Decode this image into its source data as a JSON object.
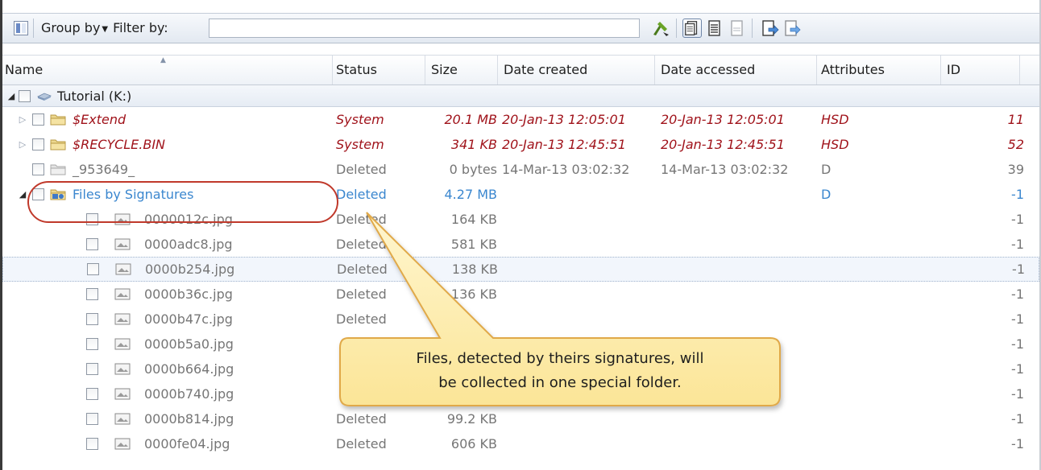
{
  "toolbar": {
    "group_by_label": "Group by",
    "filter_label": "Filter by:",
    "filter_value": "",
    "icons": [
      "panel-toggle-icon",
      "recover-icon",
      "view-details-icon",
      "view-list-icon",
      "view-plain-icon",
      "export-icon",
      "export-alt-icon"
    ]
  },
  "columns": {
    "name": "Name",
    "status": "Status",
    "size": "Size",
    "date_created": "Date created",
    "date_accessed": "Date accessed",
    "attributes": "Attributes",
    "id": "ID"
  },
  "rows": [
    {
      "name": "Tutorial (K:)",
      "status": "",
      "size": "",
      "created": "",
      "accessed": "",
      "attributes": "",
      "id": "",
      "kind": "root"
    },
    {
      "name": "$Extend",
      "status": "System",
      "size": "20.1 MB",
      "created": "20-Jan-13 12:05:01",
      "accessed": "20-Jan-13 12:05:01",
      "attributes": "HSD",
      "id": "11",
      "kind": "system"
    },
    {
      "name": "$RECYCLE.BIN",
      "status": "System",
      "size": "341 KB",
      "created": "20-Jan-13 12:45:51",
      "accessed": "20-Jan-13 12:45:51",
      "attributes": "HSD",
      "id": "52",
      "kind": "system"
    },
    {
      "name": "_953649_",
      "status": "Deleted",
      "size": "0 bytes",
      "created": "14-Mar-13 03:02:32",
      "accessed": "14-Mar-13 03:02:32",
      "attributes": "D",
      "id": "39",
      "kind": "deleted-folder"
    },
    {
      "name": "Files by Signatures",
      "status": "Deleted",
      "size": "4.27 MB",
      "created": "",
      "accessed": "",
      "attributes": "D",
      "id": "-1",
      "kind": "signatures"
    },
    {
      "name": "0000012c.jpg",
      "status": "Deleted",
      "size": "164 KB",
      "created": "",
      "accessed": "",
      "attributes": "",
      "id": "-1",
      "kind": "file"
    },
    {
      "name": "0000adc8.jpg",
      "status": "Deleted",
      "size": "581 KB",
      "created": "",
      "accessed": "",
      "attributes": "",
      "id": "-1",
      "kind": "file"
    },
    {
      "name": "0000b254.jpg",
      "status": "Deleted",
      "size": "138 KB",
      "created": "",
      "accessed": "",
      "attributes": "",
      "id": "-1",
      "kind": "file"
    },
    {
      "name": "0000b36c.jpg",
      "status": "Deleted",
      "size": "136 KB",
      "created": "",
      "accessed": "",
      "attributes": "",
      "id": "-1",
      "kind": "file"
    },
    {
      "name": "0000b47c.jpg",
      "status": "Deleted",
      "size": "",
      "created": "",
      "accessed": "",
      "attributes": "",
      "id": "-1",
      "kind": "file"
    },
    {
      "name": "0000b5a0.jpg",
      "status": "",
      "size": "",
      "created": "",
      "accessed": "",
      "attributes": "",
      "id": "-1",
      "kind": "file"
    },
    {
      "name": "0000b664.jpg",
      "status": "",
      "size": "",
      "created": "",
      "accessed": "",
      "attributes": "",
      "id": "-1",
      "kind": "file"
    },
    {
      "name": "0000b740.jpg",
      "status": "",
      "size": "",
      "created": "",
      "accessed": "",
      "attributes": "",
      "id": "-1",
      "kind": "file"
    },
    {
      "name": "0000b814.jpg",
      "status": "Deleted",
      "size": "99.2 KB",
      "created": "",
      "accessed": "",
      "attributes": "",
      "id": "-1",
      "kind": "file"
    },
    {
      "name": "0000fe04.jpg",
      "status": "Deleted",
      "size": "606 KB",
      "created": "",
      "accessed": "",
      "attributes": "",
      "id": "-1",
      "kind": "file"
    }
  ],
  "callout": {
    "line1": "Files, detected by theirs signatures, will",
    "line2": "be collected in one special folder."
  },
  "colors": {
    "system": "#a0131b",
    "deleted": "#767676",
    "signatures": "#3b87cf",
    "callout_fill": "#fdeeb0",
    "callout_border": "#e0a94a",
    "highlight": "#c0392b"
  }
}
